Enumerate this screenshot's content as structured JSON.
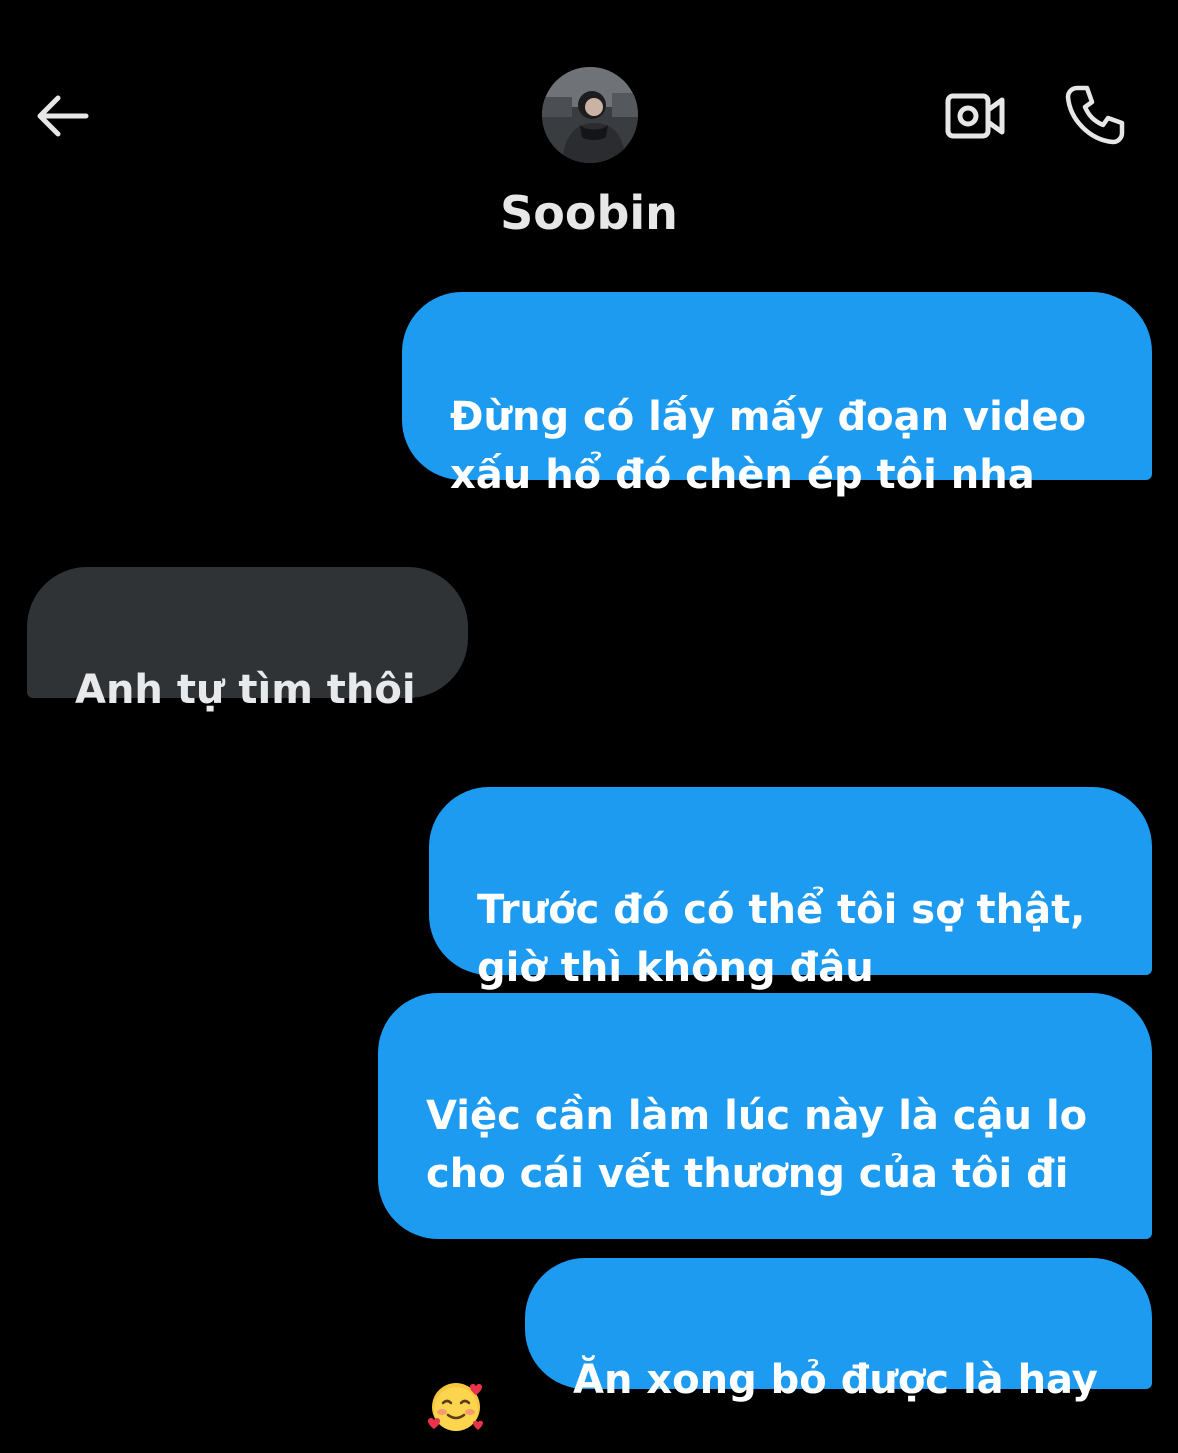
{
  "header": {
    "back_icon": "arrow-left-icon",
    "contact_name": "Soobin",
    "video_icon": "video-camera-icon",
    "call_icon": "phone-icon"
  },
  "messages": [
    {
      "direction": "outgoing",
      "text": "Đừng có lấy mấy đoạn video\nxấu hổ đó chèn ép tôi nha"
    },
    {
      "direction": "incoming",
      "text": "Anh tự tìm thôi"
    },
    {
      "direction": "outgoing",
      "text": "Trước đó có thể tôi sợ thật,\ngiờ thì không đâu"
    },
    {
      "direction": "outgoing",
      "text": "Việc cần làm lúc này là cậu lo\ncho cái vết thương của tôi đi",
      "emoji": "smiling-face-with-hearts-icon"
    },
    {
      "direction": "outgoing",
      "text": "Ăn xong bỏ được là hay"
    }
  ],
  "colors": {
    "background": "#000000",
    "outgoing_bubble": "#1d9bf0",
    "incoming_bubble": "#2f3336",
    "name_text": "#e7e7e7"
  }
}
